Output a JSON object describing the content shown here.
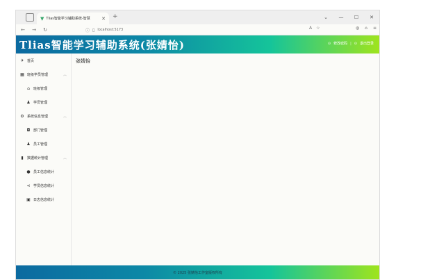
{
  "browser": {
    "tab_title": "Tlias智能学习辅助系统-智慧",
    "url": "localhost:5173"
  },
  "header": {
    "title": "Tlias智能学习辅助系统(张婧怡)",
    "change_password": "修改密码",
    "logout": "退出登录"
  },
  "sidebar": {
    "items": [
      {
        "label": "首页",
        "level": "top",
        "icon": "pin-icon"
      },
      {
        "label": "班级学员管理",
        "level": "top",
        "icon": "grid-icon",
        "expandable": true
      },
      {
        "label": "班级管理",
        "level": "sub",
        "icon": "home-icon"
      },
      {
        "label": "学员管理",
        "level": "sub",
        "icon": "user-icon"
      },
      {
        "label": "系统信息管理",
        "level": "top",
        "icon": "gear-icon",
        "expandable": true
      },
      {
        "label": "部门管理",
        "level": "sub",
        "icon": "dept-icon"
      },
      {
        "label": "员工管理",
        "level": "sub",
        "icon": "user-icon"
      },
      {
        "label": "数据统计管理",
        "level": "top",
        "icon": "chart-icon",
        "expandable": true
      },
      {
        "label": "员工信息统计",
        "level": "sub",
        "icon": "info-icon"
      },
      {
        "label": "学员信息统计",
        "level": "sub",
        "icon": "share-icon"
      },
      {
        "label": "日志信息统计",
        "level": "sub",
        "icon": "doc-icon"
      }
    ]
  },
  "main": {
    "user_name": "张婧怡"
  },
  "footer": {
    "text": "© 2025 张婧怡工作室版权所有"
  }
}
